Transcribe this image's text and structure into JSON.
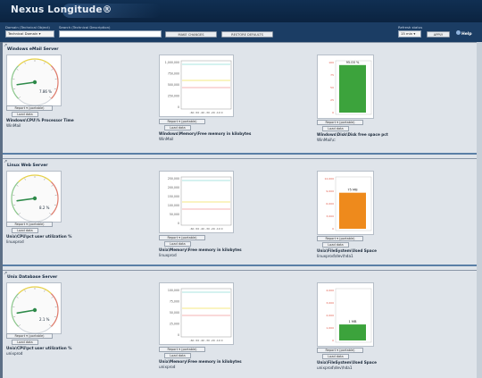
{
  "app": {
    "title": "Nexus Longitude",
    "trademark": "®"
  },
  "toolbar": {
    "domain_label": "Domain (Technical Object)",
    "domain_value": "Technical Domain",
    "search_label": "Search (Technical Description)",
    "refresh_label": "Refresh status",
    "refresh_value": "15 min",
    "btn_change": "MAKE CHANGES",
    "btn_default": "RESTORE DEFAULTS",
    "btn_apply": "APPLY",
    "help": "Help"
  },
  "sections": [
    {
      "title": "Windows eMail Server",
      "gauge_value": "7.86 %",
      "gauge_pct": 0.0786,
      "line_ticks": [
        "1,000,000",
        "750,000",
        "500,000",
        "250,000",
        "0"
      ],
      "line_x": "-60 -50 -40 -30 -20 -10 0",
      "bar_value": "95.00 %",
      "bar_fill": 0.95,
      "bar_color": "#3ca33c",
      "bar_ticks": [
        "100",
        "75",
        "50",
        "25",
        "0"
      ],
      "captions": [
        "Windows\\CPU\\% Processor Time",
        "Windows\\Memory\\Free memory in kilobytes",
        "Windows\\Disk\\Disk free space pct"
      ],
      "subcaptions": [
        "WinMail",
        "WinMail",
        "WinMail\\c:"
      ]
    },
    {
      "title": "Linux Web Server",
      "gauge_value": "8.2 %",
      "gauge_pct": 0.082,
      "line_ticks": [
        "250,000",
        "200,000",
        "150,000",
        "100,000",
        "50,000",
        "0"
      ],
      "line_x": "-60 -50 -40 -30 -20 -10 0",
      "bar_value": "75 MB",
      "bar_fill": 0.72,
      "bar_color": "#ee8a1c",
      "bar_ticks": [
        "12,000",
        "9,000",
        "6,000",
        "3,000",
        "0"
      ],
      "captions": [
        "Unix\\CPU\\pct user utilization %",
        "Unix\\Memory\\Free memory in kilobytes",
        "Unix\\FileSystem\\Used Space"
      ],
      "subcaptions": [
        "linuxprod",
        "linuxprod",
        "linuxprod\\dev\\hda1"
      ]
    },
    {
      "title": "Unix Database Server",
      "gauge_value": "2.1 %",
      "gauge_pct": 0.021,
      "line_ticks": [
        "100,000",
        "75,000",
        "50,000",
        "25,000",
        "0"
      ],
      "line_x": "-60 -50 -40 -30 -20 -10 0",
      "bar_value": "1 MB",
      "bar_fill": 0.32,
      "bar_color": "#3ca33c",
      "bar_ticks": [
        "4,000",
        "3,000",
        "2,000",
        "1,000",
        "0"
      ],
      "captions": [
        "Unix\\CPU\\pct user utilization %",
        "Unix\\Memory\\Free memory in kilobytes",
        "Unix\\FileSystem\\Used Space"
      ],
      "subcaptions": [
        "unixprod",
        "unixprod",
        "unixprod\\dev\\hda1"
      ]
    }
  ],
  "buttons": {
    "report": "Report ▾ (portable)",
    "load": "Load data"
  }
}
